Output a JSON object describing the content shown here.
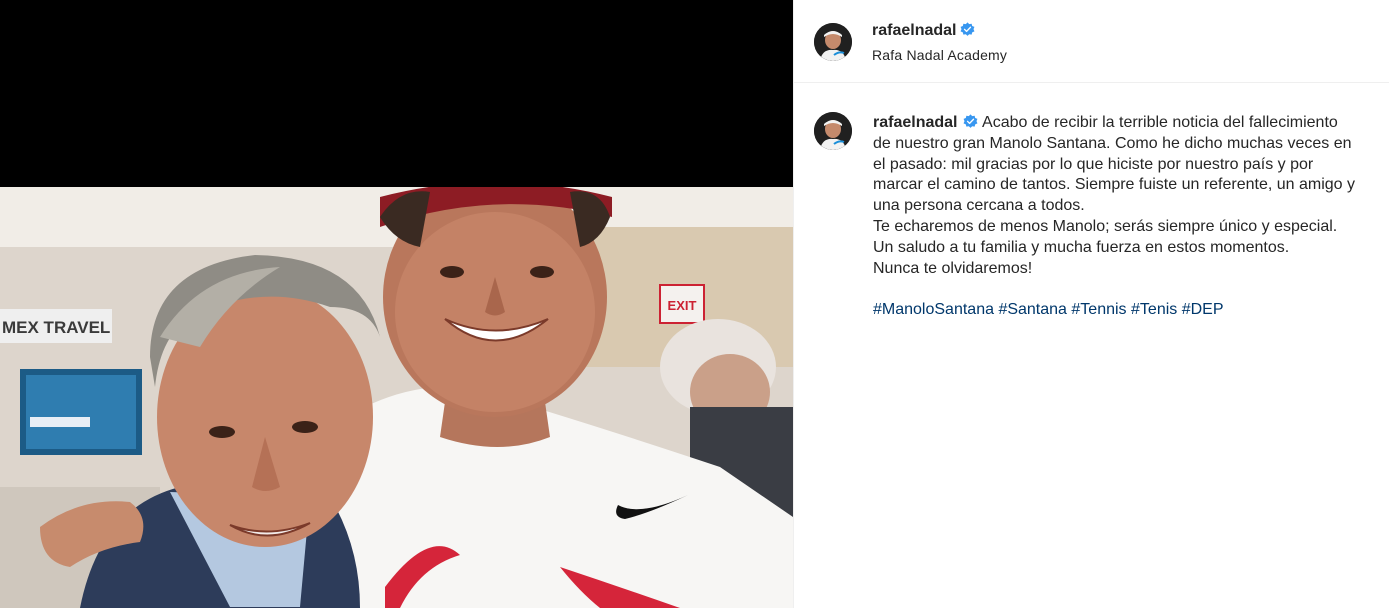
{
  "post": {
    "username": "rafaelnadal",
    "verified": true,
    "location": "Rafa Nadal Academy",
    "caption_lines": [
      "Acabo de recibir la terrible noticia del fallecimiento",
      "de nuestro gran Manolo Santana. Como he dicho muchas veces en",
      "el pasado: mil gracias por lo que hiciste por nuestro país y por",
      "marcar el camino de tantos. Siempre fuiste un referente, un amigo y",
      "una persona cercana a todos.",
      "Te echaremos de menos Manolo; serás siempre único y especial.",
      "Un saludo a tu familia y mucha fuerza en estos momentos.",
      "Nunca te olvidaremos!"
    ],
    "hashtags": [
      "#ManoloSantana",
      "#Santana",
      "#Tennis",
      "#Tenis",
      "#DEP"
    ]
  },
  "photo_text": {
    "sponsor_banner": "MEX TRAVEL",
    "exit_sign": "EXIT"
  },
  "colors": {
    "verified_badge": "#3897f0",
    "hashtag_link": "#00376b",
    "text": "#262626",
    "divider": "#efefef",
    "media_background": "#000000"
  },
  "icons": {
    "verified": "verified-badge-icon",
    "avatar": "profile-avatar"
  }
}
